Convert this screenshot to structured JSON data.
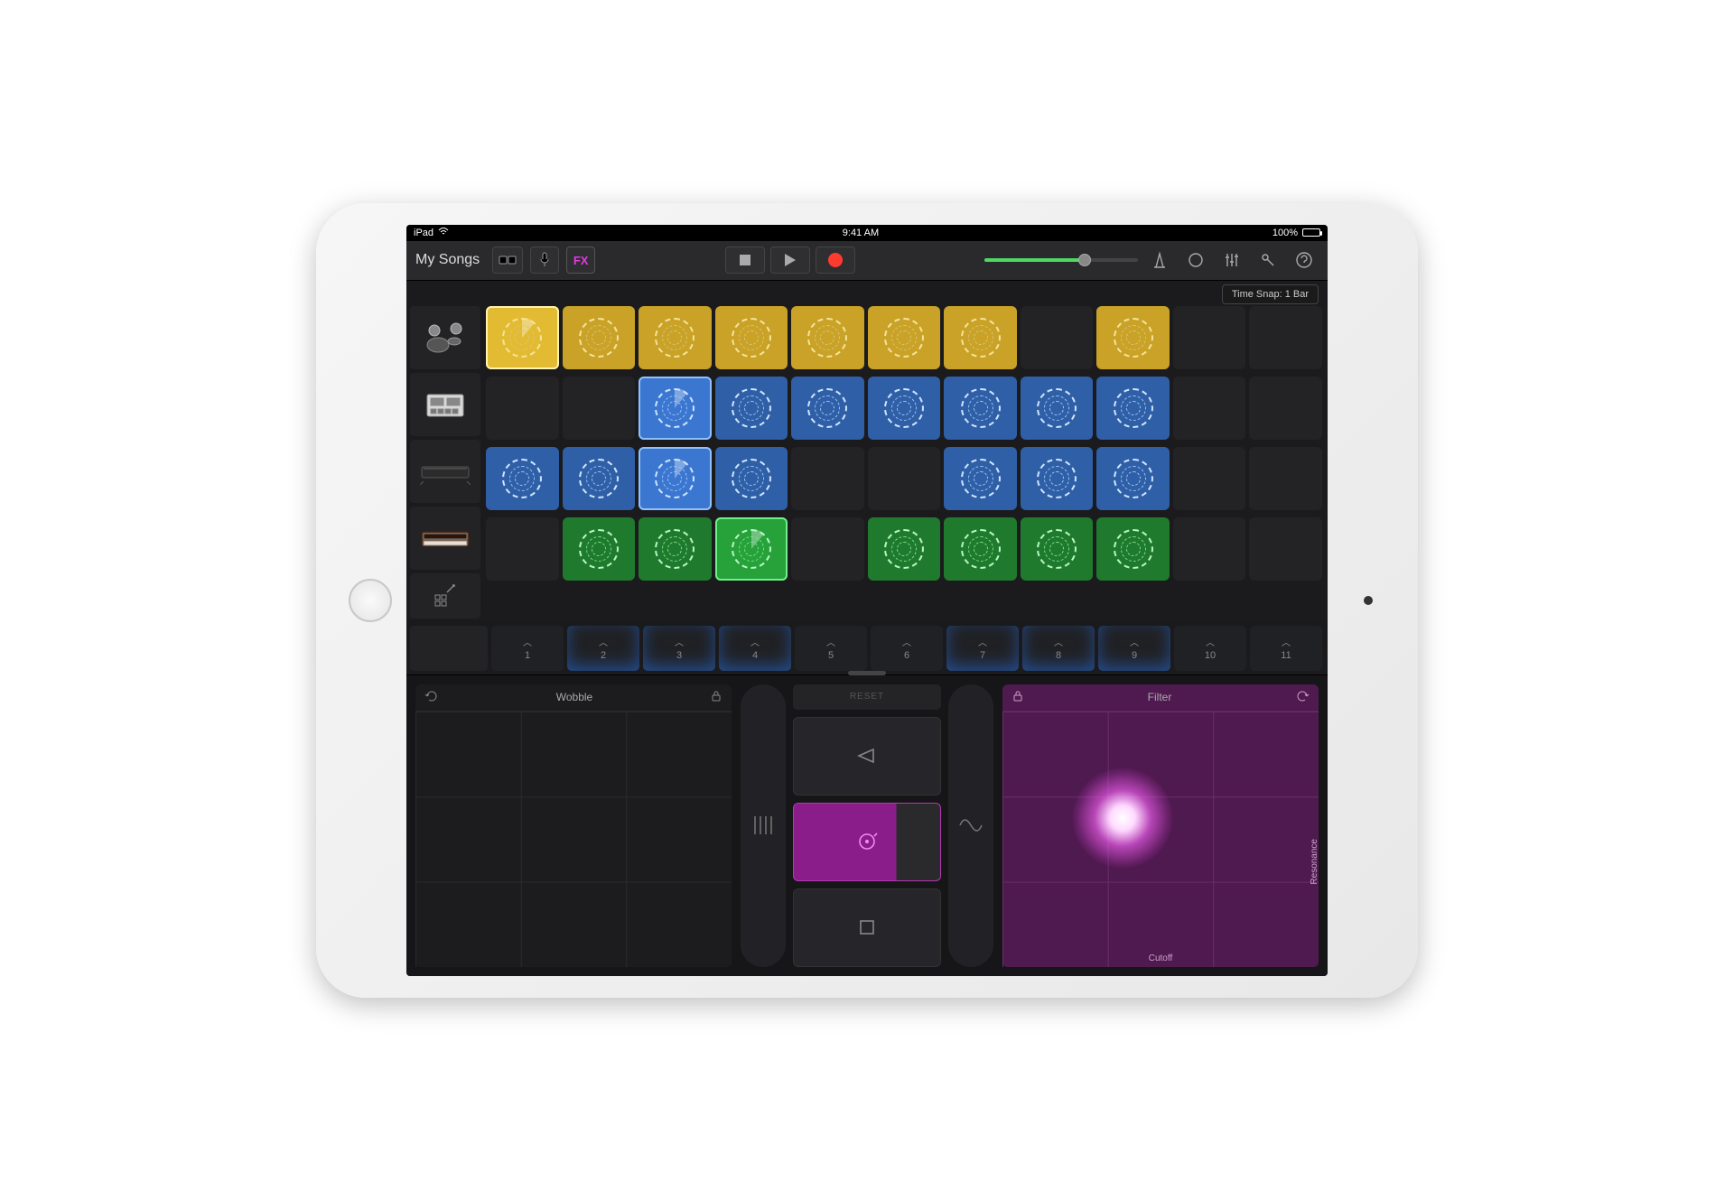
{
  "status": {
    "device": "iPad",
    "time": "9:41 AM",
    "battery_pct": "100%"
  },
  "toolbar": {
    "title": "My Songs",
    "fx_label": "FX",
    "time_snap": "Time Snap: 1 Bar"
  },
  "tracks": [
    {
      "name": "drums"
    },
    {
      "name": "sampler"
    },
    {
      "name": "keyboard"
    },
    {
      "name": "synth"
    }
  ],
  "grid": {
    "cols": 11,
    "rows": [
      {
        "color": "yellow",
        "filled": [
          1,
          2,
          3,
          4,
          5,
          6,
          7,
          9
        ],
        "selected": 1
      },
      {
        "color": "blue",
        "filled": [
          3,
          4,
          5,
          6,
          7,
          8,
          9
        ],
        "selected": 3
      },
      {
        "color": "blue",
        "filled": [
          1,
          2,
          3,
          4,
          7,
          8,
          9
        ],
        "selected": 3
      },
      {
        "color": "green",
        "filled": [
          2,
          3,
          4,
          6,
          7,
          8,
          9
        ],
        "selected": 4
      }
    ]
  },
  "triggers": {
    "labels": [
      "1",
      "2",
      "3",
      "4",
      "5",
      "6",
      "7",
      "8",
      "9",
      "10",
      "11"
    ],
    "glows": [
      2,
      3,
      4,
      7,
      8,
      9
    ]
  },
  "fx": {
    "left": {
      "title": "Wobble"
    },
    "right": {
      "title": "Filter",
      "xlabel": "Cutoff",
      "ylabel": "Resonance"
    },
    "center": {
      "reset": "RESET"
    }
  }
}
